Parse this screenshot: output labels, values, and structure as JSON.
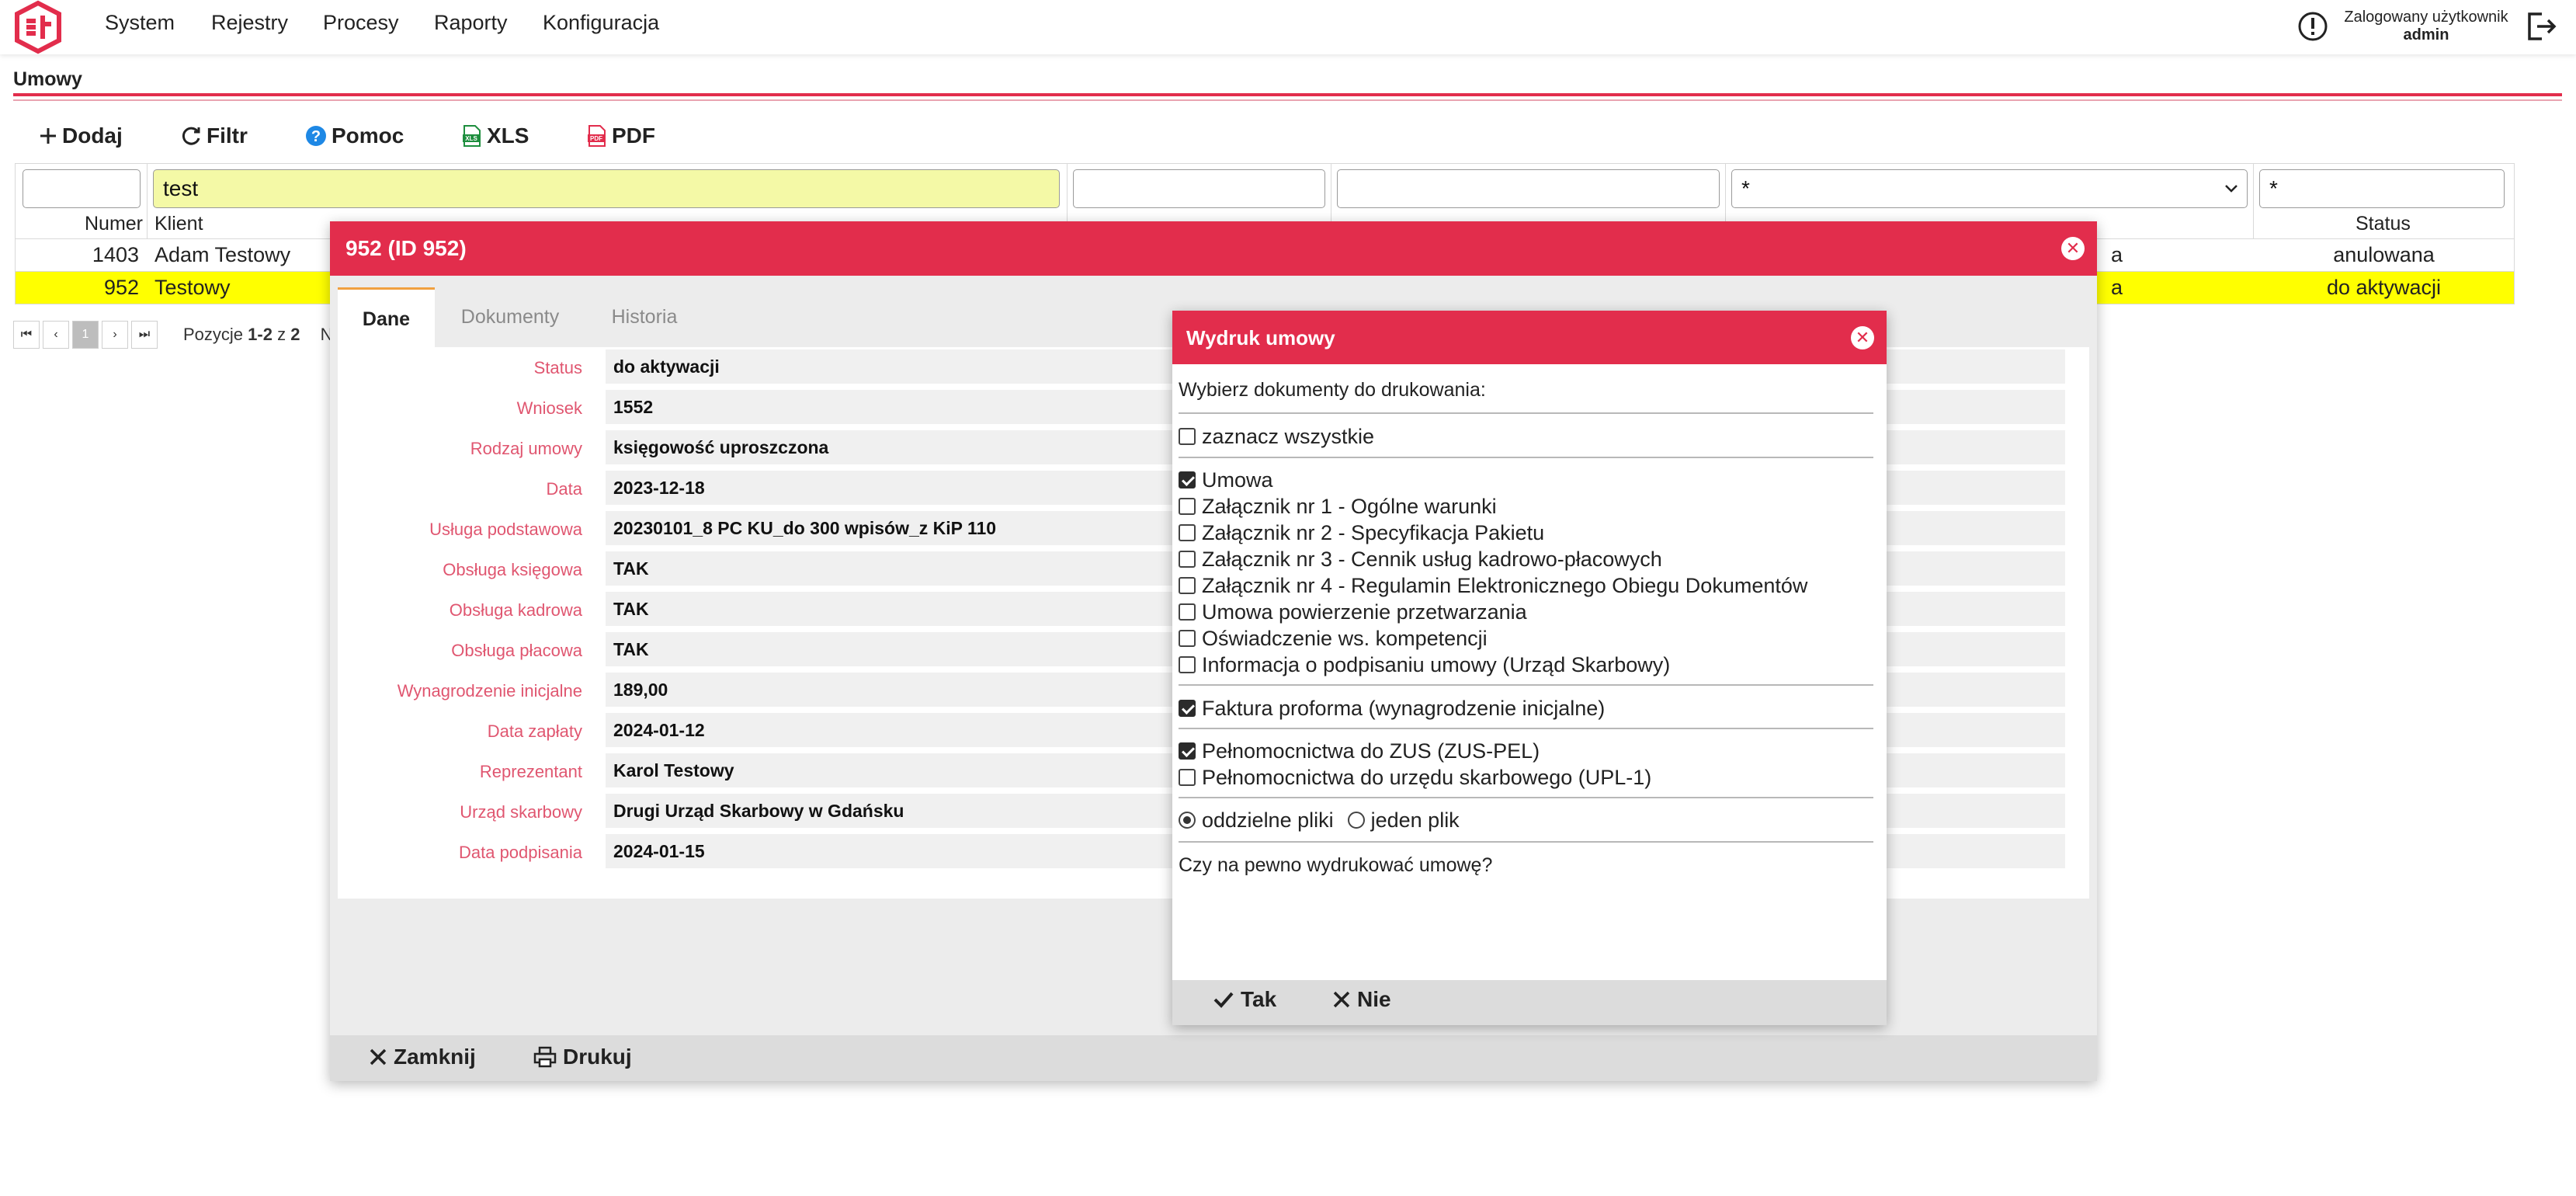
{
  "nav": {
    "menu": [
      "System",
      "Rejestry",
      "Procesy",
      "Raporty",
      "Konfiguracja"
    ],
    "user_label": "Zalogowany użytkownik",
    "user_name": "admin"
  },
  "page": {
    "title": "Umowy"
  },
  "toolbar": {
    "add": "Dodaj",
    "filter": "Filtr",
    "help": "Pomoc",
    "xls": "XLS",
    "pdf": "PDF"
  },
  "grid": {
    "filters": {
      "numer": "",
      "klient": "test",
      "nip": "",
      "data": "",
      "select": "*",
      "status": "*"
    },
    "headers": {
      "numer": "Numer",
      "klient": "Klient",
      "status": "Status"
    },
    "rows": [
      {
        "numer": "1403",
        "klient": "Adam Testowy",
        "col_tail": "a",
        "status": "anulowana"
      },
      {
        "numer": "952",
        "klient": "Testowy",
        "col_tail": "a",
        "status": "do aktywacji"
      }
    ]
  },
  "pager": {
    "first": "⏮",
    "prev": "‹",
    "page": "1",
    "next": "›",
    "last": "⏭",
    "label": "Pozycje",
    "range": "1-2",
    "of": "z",
    "total": "2",
    "tail": "N"
  },
  "contract_dialog": {
    "title": "952 (ID 952)",
    "tabs": [
      "Dane",
      "Dokumenty",
      "Historia"
    ],
    "fields": [
      {
        "label": "Status",
        "value": "do aktywacji"
      },
      {
        "label": "Wniosek",
        "value": "1552"
      },
      {
        "label": "Rodzaj umowy",
        "value": "księgowość uproszczona"
      },
      {
        "label": "Data",
        "value": "2023-12-18"
      },
      {
        "label": "Usługa podstawowa",
        "value": "20230101_8 PC KU_do 300 wpisów_z KiP 110"
      },
      {
        "label": "Obsługa księgowa",
        "value": "TAK"
      },
      {
        "label": "Obsługa kadrowa",
        "value": "TAK"
      },
      {
        "label": "Obsługa płacowa",
        "value": "TAK"
      },
      {
        "label": "Wynagrodzenie inicjalne",
        "value": "189,00"
      },
      {
        "label": "Data zapłaty",
        "value": "2024-01-12"
      },
      {
        "label": "Reprezentant",
        "value": "Karol Testowy"
      },
      {
        "label": "Urząd skarbowy",
        "value": "Drugi Urząd Skarbowy w Gdańsku"
      },
      {
        "label": "Data podpisania",
        "value": "2024-01-15"
      }
    ],
    "close": "Zamknij",
    "print": "Drukuj"
  },
  "print_dialog": {
    "title": "Wydruk umowy",
    "intro": "Wybierz dokumenty do drukowania:",
    "select_all": "zaznacz wszystkie",
    "documents": [
      {
        "label": "Umowa",
        "checked": true
      },
      {
        "label": "Załącznik nr 1 - Ogólne warunki",
        "checked": false
      },
      {
        "label": "Załącznik nr 2 - Specyfikacja Pakietu",
        "checked": false
      },
      {
        "label": "Załącznik nr 3 - Cennik usług kadrowo-płacowych",
        "checked": false
      },
      {
        "label": "Załącznik nr 4 - Regulamin Elektronicznego Obiegu Dokumentów",
        "checked": false
      },
      {
        "label": "Umowa powierzenie przetwarzania",
        "checked": false
      },
      {
        "label": "Oświadczenie ws. kompetencji",
        "checked": false
      },
      {
        "label": "Informacja o podpisaniu umowy (Urząd Skarbowy)",
        "checked": false
      }
    ],
    "invoice": {
      "label": "Faktura proforma (wynagrodzenie inicjalne)",
      "checked": true
    },
    "proxies": [
      {
        "label": "Pełnomocnictwa do ZUS (ZUS-PEL)",
        "checked": true
      },
      {
        "label": "Pełnomocnictwa do urzędu skarbowego (UPL-1)",
        "checked": false
      }
    ],
    "file_mode": {
      "separate": "oddzielne pliki",
      "single": "jeden plik",
      "selected": "separate"
    },
    "question": "Czy na pewno wydrukować umowę?",
    "yes": "Tak",
    "no": "Nie"
  },
  "colors": {
    "accent": "#e22d4c",
    "highlight_row": "#ffff00",
    "label_red": "#e05670",
    "filter_yellow": "#f4f9a6"
  }
}
